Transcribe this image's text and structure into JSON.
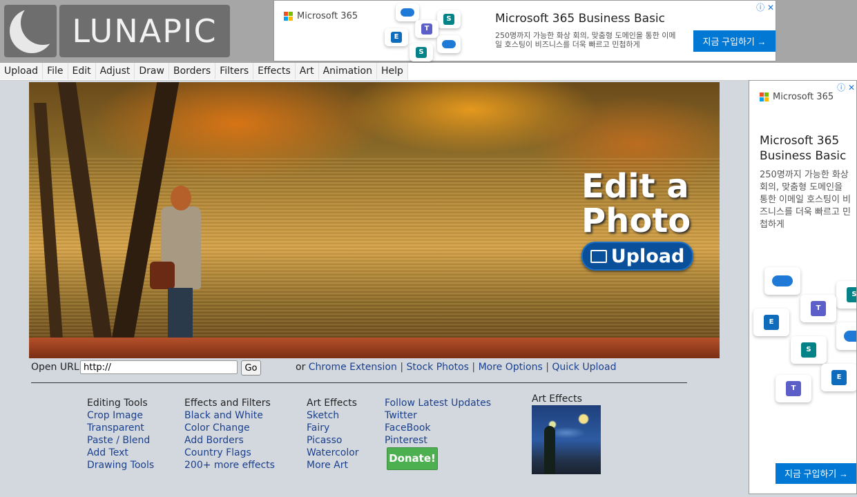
{
  "brand": {
    "name": "LUNAPIC"
  },
  "top_ad": {
    "brand": "Microsoft 365",
    "title": "Microsoft 365 Business Basic",
    "description": "250명까지 가능한 화상 회의, 맞춤형 도메인을 통한 이메일 호스팅이 비즈니스를 더욱 빠르고 민첩하게",
    "cta": "지금 구입하기 →"
  },
  "menu": [
    "Upload",
    "File",
    "Edit",
    "Adjust",
    "Draw",
    "Borders",
    "Filters",
    "Effects",
    "Art",
    "Animation",
    "Help"
  ],
  "hero": {
    "title_line1": "Edit a",
    "title_line2": "Photo",
    "upload_label": "Upload"
  },
  "url_bar": {
    "label": "Open URL:",
    "value": "http://",
    "go": "Go",
    "or": "or",
    "links": [
      "Chrome Extension",
      "Stock Photos",
      "More Options",
      "Quick Upload"
    ],
    "separator": "|"
  },
  "columns": {
    "editing": {
      "head": "Editing Tools",
      "links": [
        "Crop Image",
        "Transparent",
        "Paste / Blend",
        "Add Text",
        "Drawing Tools"
      ]
    },
    "effects": {
      "head": "Effects and Filters",
      "links": [
        "Black and White",
        "Color Change",
        "Add Borders",
        "Country Flags",
        "200+ more effects"
      ]
    },
    "art": {
      "head": "Art Effects",
      "links": [
        "Sketch",
        "Fairy",
        "Picasso",
        "Watercolor",
        "More Art"
      ]
    },
    "social": {
      "links": [
        "Follow Latest Updates",
        "Twitter",
        "FaceBook",
        "Pinterest"
      ],
      "donate": "Donate!"
    }
  },
  "art_preview": {
    "label": "Art Effects"
  },
  "side_ad": {
    "brand": "Microsoft 365",
    "title": "Microsoft 365 Business Basic",
    "description": "250명까지 가능한 화상 회의, 맞춤형 도메인을 통한 이메일 호스팅이 비즈니스를 더욱 빠르고 민첩하게",
    "cta": "지금 구입하기 →"
  },
  "colors": {
    "link": "#1a3f8c",
    "upload_button": "#0a4f99",
    "donate": "#4caf50",
    "ad_cta": "#0078d4"
  }
}
